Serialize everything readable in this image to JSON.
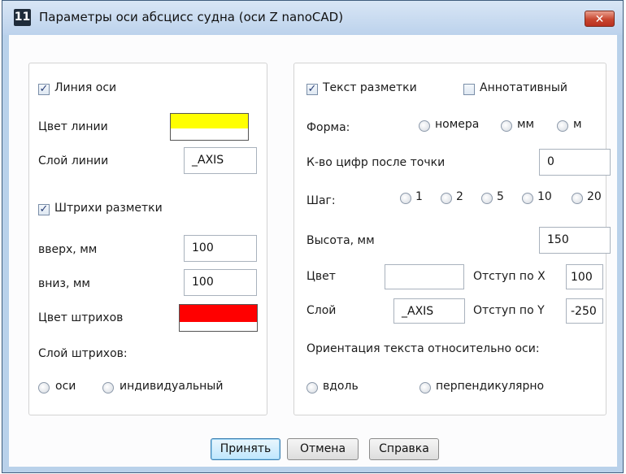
{
  "window": {
    "title": "Параметры оси абсцисс судна (оси Z nanoCAD)",
    "app_icon": "11",
    "close_glyph": "✕"
  },
  "left": {
    "axis_line_label": "Линия оси",
    "axis_line_checked": true,
    "line_color_label": "Цвет линии",
    "line_color": "#ffff00",
    "line_layer_label": "Слой линии",
    "line_layer_value": "_AXIS",
    "ticks_label": "Штрихи разметки",
    "ticks_checked": true,
    "up_label": "вверх, мм",
    "up_value": "100",
    "down_label": "вниз, мм",
    "down_value": "100",
    "ticks_color_label": "Цвет штрихов",
    "ticks_color": "#ff0000",
    "ticks_layer_label": "Слой штрихов:",
    "layer_options": [
      "оси",
      "индивидуальный"
    ]
  },
  "right": {
    "text_label": "Текст разметки",
    "text_checked": true,
    "annotative_label": "Аннотативный",
    "annotative_checked": false,
    "form_label": "Форма:",
    "form_options": [
      "номера",
      "мм",
      "м"
    ],
    "digits_label": "К-во цифр после точки",
    "digits_value": "0",
    "step_label": "Шаг:",
    "step_options": [
      "1",
      "2",
      "5",
      "10",
      "20"
    ],
    "height_label": "Высота, мм",
    "height_value": "150",
    "color_label": "Цвет",
    "color_value": "",
    "offset_x_label": "Отступ по X",
    "offset_x_value": "100",
    "layer_label": "Слой",
    "layer_value": "_AXIS",
    "offset_y_label": "Отступ по Y",
    "offset_y_value": "-250",
    "orientation_label": "Ориентация текста относительно оси:",
    "orientation_options": [
      "вдоль",
      "перпендикулярно"
    ]
  },
  "buttons": {
    "accept": "Принять",
    "cancel": "Отмена",
    "help": "Справка"
  },
  "check_glyph": "✓"
}
